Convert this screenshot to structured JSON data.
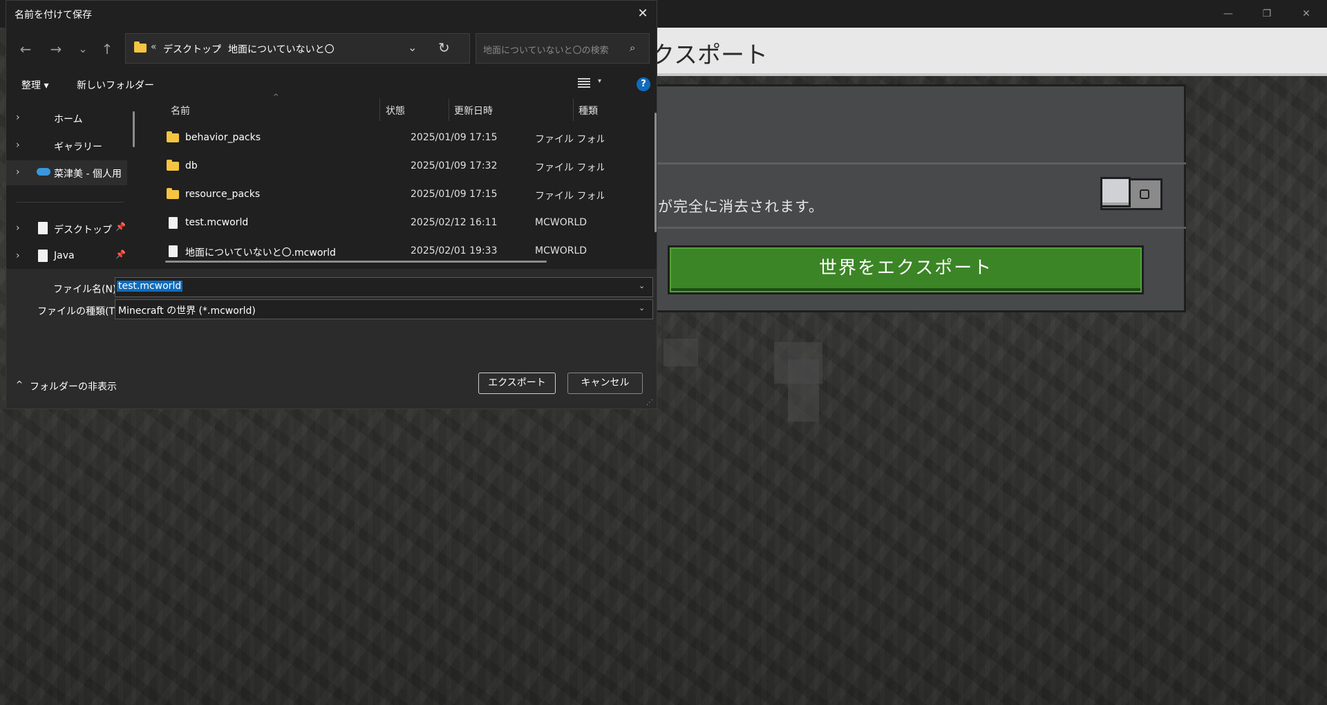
{
  "background_app": {
    "header_title": "クスポート",
    "description": "が完全に消去されます。",
    "export_button_label": "世界をエクスポート",
    "window_controls": {
      "minimize": "—",
      "restore": "❐",
      "close": "✕"
    },
    "colors": {
      "export_green": "#3c8527",
      "panel": "#48494a",
      "header": "#e8e8e8"
    }
  },
  "dialog": {
    "title": "名前を付けて保存",
    "close_glyph": "✕",
    "nav": {
      "back": "←",
      "forward": "→",
      "recent": "⌄",
      "up": "↑"
    },
    "address": {
      "overflow": "«",
      "segments": [
        "デスクトップ",
        "地面についていないと〇"
      ],
      "separator": "›",
      "dropdown_glyph": "⌄",
      "refresh_glyph": "↻"
    },
    "search": {
      "placeholder": "地面についていないと〇の検索",
      "icon": "search-icon"
    },
    "toolbar": {
      "organize": "整理 ▾",
      "new_folder": "新しいフォルダー",
      "view_caret": "▾",
      "help": "?"
    },
    "nav_pane": {
      "items": [
        {
          "label": "ホーム",
          "icon": "home-icon",
          "chevron": "›"
        },
        {
          "label": "ギャラリー",
          "icon": "gallery-icon",
          "chevron": "›"
        },
        {
          "label": "菜津美 - 個人用",
          "icon": "onedrive-icon",
          "chevron": "›"
        },
        {
          "label": "デスクトップ",
          "icon": "desktop-icon",
          "chevron": "›",
          "pin": "📌"
        },
        {
          "label": "Java",
          "icon": "document-icon",
          "chevron": "›",
          "pin": "📌"
        }
      ]
    },
    "columns": {
      "name": "名前",
      "status": "状態",
      "modified": "更新日時",
      "type": "種類",
      "sort_glyph": "^"
    },
    "files": [
      {
        "name": "behavior_packs",
        "date": "2025/01/09 17:15",
        "type": "ファイル フォルダー",
        "kind": "folder"
      },
      {
        "name": "db",
        "date": "2025/01/09 17:32",
        "type": "ファイル フォルダー",
        "kind": "folder"
      },
      {
        "name": "resource_packs",
        "date": "2025/01/09 17:15",
        "type": "ファイル フォルダー",
        "kind": "folder"
      },
      {
        "name": "test.mcworld",
        "date": "2025/02/12 16:11",
        "type": "MCWORLD",
        "kind": "file"
      },
      {
        "name": "地面についていないと〇.mcworld",
        "date": "2025/02/01 19:33",
        "type": "MCWORLD",
        "kind": "file"
      }
    ],
    "filename_label": "ファイル名(N):",
    "filename_value": "test.mcworld",
    "filetype_label": "ファイルの種類(T):",
    "filetype_value": "Minecraft の世界 (*.mcworld)",
    "field_caret": "⌄",
    "hide_folders": "フォルダーの非表示",
    "hide_chevron": "^",
    "export_button": "エクスポート",
    "cancel_button": "キャンセル",
    "grip_glyph": "⋰"
  }
}
